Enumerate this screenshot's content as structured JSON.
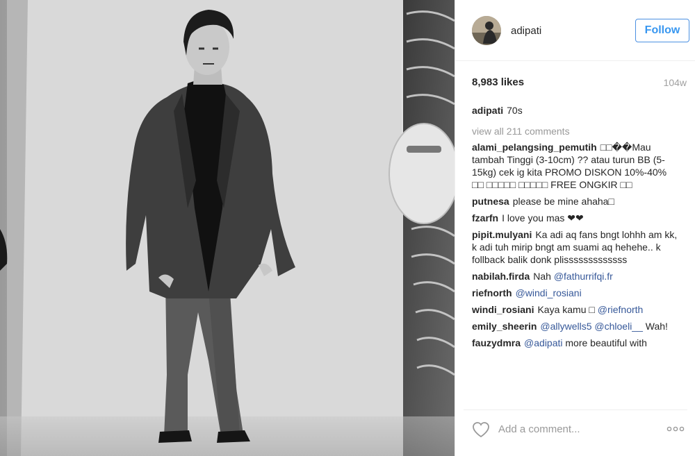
{
  "post": {
    "username": "adipati",
    "follow_label": "Follow",
    "likes": "8,983 likes",
    "age": "104w"
  },
  "caption": {
    "author": "adipati",
    "text": "70s"
  },
  "view_all": "view all 211 comments",
  "comments": [
    {
      "author": "alami_pelangsing_pemutih",
      "text": "□□��Mau tambah Tinggi (3-10cm) ?? atau turun BB (5-15kg) cek ig kita PROMO DISKON 10%-40% □□ □□□□□ □□□□□ FREE ONGKIR □□"
    },
    {
      "author": "putnesa",
      "text": "please be mine ahaha□"
    },
    {
      "author": "fzarfn",
      "text": "I love you mas ❤❤"
    },
    {
      "author": "pipit.mulyani",
      "text": "Ka adi aq fans bngt lohhh am kk, k adi tuh mirip bngt am suami aq hehehe.. k follback balik donk plisssssssssssss"
    },
    {
      "author": "nabilah.firda",
      "text": "Nah",
      "mention": "@fathurrifqi.fr"
    },
    {
      "author": "riefnorth",
      "text": "",
      "mention": "@windi_rosiani"
    },
    {
      "author": "windi_rosiani",
      "text": "Kaya kamu □",
      "mention": "@riefnorth"
    },
    {
      "author": "emily_sheerin",
      "text": "",
      "mention": "@allywells5 @chloeli__",
      "text_after": "Wah!"
    },
    {
      "author": "fauzydmra",
      "text": "",
      "mention": "@adipati",
      "text_after": "more beautiful with"
    }
  ],
  "footer": {
    "comment_placeholder": "Add a comment..."
  },
  "icons": {
    "heart": "heart-icon",
    "more": "more-options-icon"
  },
  "colors": {
    "follow": "#3897f0",
    "mention": "#365899",
    "muted": "#999999"
  }
}
